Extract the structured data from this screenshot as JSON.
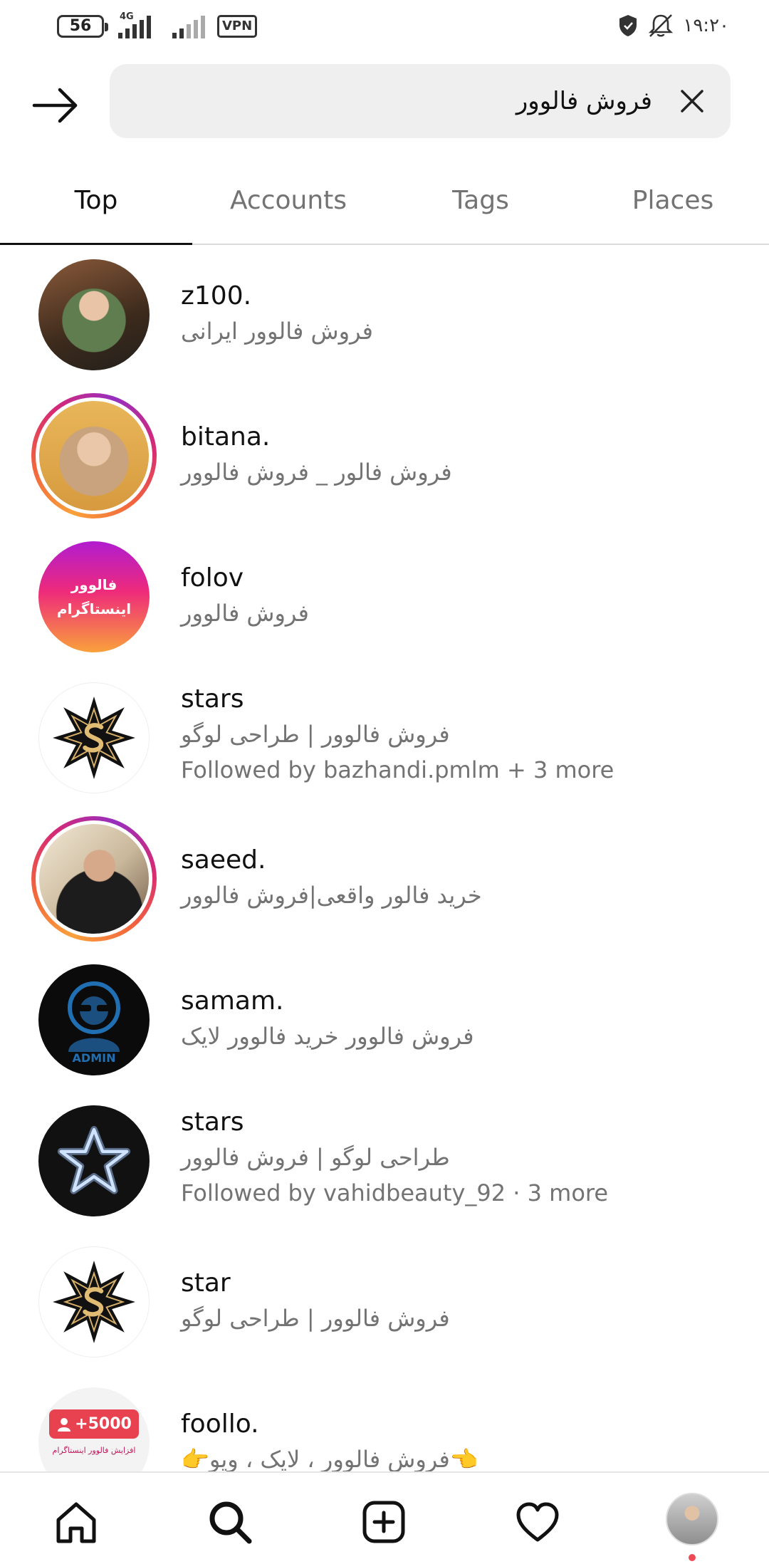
{
  "status_bar": {
    "battery": "56",
    "network": "4G",
    "vpn": "VPN",
    "time": "۱۹:۲۰"
  },
  "search": {
    "query": "فروش فالوور"
  },
  "tabs": [
    {
      "label": "Top",
      "active": true
    },
    {
      "label": "Accounts",
      "active": false
    },
    {
      "label": "Tags",
      "active": false
    },
    {
      "label": "Places",
      "active": false
    }
  ],
  "results": [
    {
      "username": "z100.",
      "bio": "فروش فالوور ایرانی",
      "followed_by": "",
      "avatar": "girl-photo",
      "story_ring": false
    },
    {
      "username": "bitana.",
      "bio": "فروش فالور _ فروش فالوور",
      "followed_by": "",
      "avatar": "woman-photo",
      "story_ring": true
    },
    {
      "username": "folov",
      "bio": "فروش فالوور",
      "followed_by": "",
      "avatar": "gradient-logo",
      "avatar_text": [
        "فالوور",
        "اینستاگرام"
      ],
      "story_ring": false
    },
    {
      "username": "stars",
      "bio": "فروش فالوور | طراحی لوگو",
      "followed_by": "Followed by bazhandi.pmlm + 3 more",
      "avatar": "star-s-logo",
      "story_ring": false
    },
    {
      "username": "saeed.",
      "bio": "خرید فالور واقعی|فروش فالوور",
      "followed_by": "",
      "avatar": "man-photo",
      "story_ring": true
    },
    {
      "username": "samam.",
      "bio": "فروش فالوور خرید فالوور لایک",
      "followed_by": "",
      "avatar": "admin-logo",
      "avatar_text": [
        "ADMIN"
      ],
      "story_ring": false
    },
    {
      "username": "stars",
      "bio": "طراحی لوگو | فروش فالوور",
      "followed_by": "Followed by vahidbeauty_92 · 3 more",
      "avatar": "neon-star",
      "story_ring": false
    },
    {
      "username": "star",
      "bio": "فروش فالوور | طراحی لوگو",
      "followed_by": "",
      "avatar": "star-s-logo",
      "story_ring": false
    },
    {
      "username": "foollo.",
      "bio": "👈فروش فالوور ، لایک ، ویو👉",
      "followed_by": "",
      "avatar": "plus-5000-logo",
      "avatar_text": [
        "+5000",
        "افزایش فالوور اینستاگرام"
      ],
      "story_ring": false
    }
  ],
  "bottom_nav": [
    "home-icon",
    "search-icon",
    "create-icon",
    "activity-icon",
    "profile-avatar"
  ],
  "colors": {
    "accent_ring": [
      "#f9a13b",
      "#d62976",
      "#962fbf"
    ],
    "notification_dot": "#ed4956",
    "secondary_text": "#737373",
    "search_bg": "#efefef"
  }
}
